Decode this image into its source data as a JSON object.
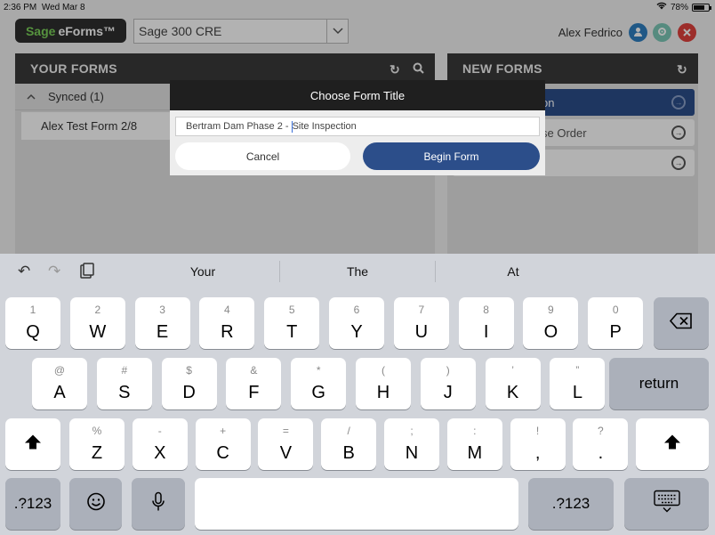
{
  "status": {
    "time": "2:36 PM",
    "date": "Wed Mar 8",
    "battery": "78%",
    "battery_level": 0.78
  },
  "header": {
    "logo_prefix": "Sage",
    "logo_text": "eForms™",
    "company": "Sage 300 CRE",
    "user_name": "Alex Fedrico"
  },
  "your_forms": {
    "title": "YOUR FORMS",
    "group_label": "Synced (1)",
    "items": [
      "Alex Test Form 2/8"
    ]
  },
  "new_forms": {
    "title": "NEW FORMS",
    "items": [
      "on",
      "se Order",
      ""
    ]
  },
  "dialog": {
    "title": "Choose Form Title",
    "input_value_before": "Bertram Dam Phase 2 - ",
    "input_value_after": "Site Inspection",
    "cancel": "Cancel",
    "begin": "Begin Form"
  },
  "keyboard": {
    "suggestions": [
      "Your",
      "The",
      "At"
    ],
    "row1": [
      [
        "1",
        "Q"
      ],
      [
        "2",
        "W"
      ],
      [
        "3",
        "E"
      ],
      [
        "4",
        "R"
      ],
      [
        "5",
        "T"
      ],
      [
        "6",
        "Y"
      ],
      [
        "7",
        "U"
      ],
      [
        "8",
        "I"
      ],
      [
        "9",
        "O"
      ],
      [
        "0",
        "P"
      ]
    ],
    "row2": [
      [
        "@",
        "A"
      ],
      [
        "#",
        "S"
      ],
      [
        "$",
        "D"
      ],
      [
        "&",
        "F"
      ],
      [
        "*",
        "G"
      ],
      [
        "(",
        "H"
      ],
      [
        ")",
        "J"
      ],
      [
        "’",
        "K"
      ],
      [
        "”",
        "L"
      ]
    ],
    "row3": [
      [
        "%",
        "Z"
      ],
      [
        "-",
        "X"
      ],
      [
        "+",
        "C"
      ],
      [
        "=",
        "V"
      ],
      [
        "/",
        "B"
      ],
      [
        ";",
        "N"
      ],
      [
        ":",
        "M"
      ],
      [
        "!",
        ","
      ],
      [
        "?",
        "."
      ]
    ],
    "return_label": "return",
    "numbers_label": ".?123",
    "icons": {
      "backspace": "backspace-icon",
      "shift": "shift-icon",
      "emoji": "emoji-icon",
      "mic": "microphone-icon",
      "hide": "keyboard-hide-icon"
    }
  },
  "colors": {
    "accent": "#2c4e8a",
    "header_bg": "#3a3a3a",
    "logo_green": "#7bd15a"
  }
}
